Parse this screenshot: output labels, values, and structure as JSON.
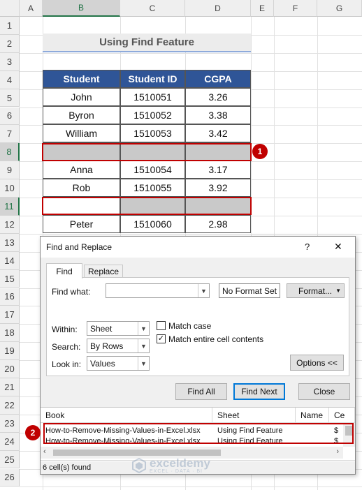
{
  "sheet": {
    "columns": [
      "A",
      "B",
      "C",
      "D",
      "E",
      "F",
      "G"
    ],
    "rows": [
      "1",
      "2",
      "3",
      "4",
      "5",
      "6",
      "7",
      "8",
      "9",
      "10",
      "11",
      "12",
      "13",
      "14",
      "15",
      "16",
      "17",
      "18",
      "19",
      "20",
      "21",
      "22",
      "23",
      "24",
      "25",
      "26"
    ],
    "title": "Using Find Feature",
    "table": {
      "headers": [
        "Student",
        "Student ID",
        "CGPA"
      ],
      "rows": [
        [
          "John",
          "1510051",
          "3.26"
        ],
        [
          "Byron",
          "1510052",
          "3.38"
        ],
        [
          "William",
          "1510053",
          "3.42"
        ],
        [
          "",
          "",
          ""
        ],
        [
          "Anna",
          "1510054",
          "3.17"
        ],
        [
          "Rob",
          "1510055",
          "3.92"
        ],
        [
          "",
          "",
          ""
        ],
        [
          "Peter",
          "1510060",
          "2.98"
        ]
      ]
    },
    "badges": [
      "1",
      "2"
    ]
  },
  "dialog": {
    "title": "Find and Replace",
    "help": "?",
    "close": "✕",
    "tabs": [
      "Find",
      "Replace"
    ],
    "find_what_label": "Find what:",
    "find_what_value": "",
    "no_format": "No Format Set",
    "format_btn": "Format...",
    "within_label": "Within:",
    "within_value": "Sheet",
    "search_label": "Search:",
    "search_value": "By Rows",
    "lookin_label": "Look in:",
    "lookin_value": "Values",
    "match_case": "Match case",
    "match_entire": "Match entire cell contents",
    "match_case_checked": false,
    "match_entire_checked": true,
    "options_btn": "Options <<",
    "find_all": "Find All",
    "find_next": "Find Next",
    "close_btn": "Close",
    "results": {
      "headers": [
        "Book",
        "Sheet",
        "Name",
        "Ce"
      ],
      "rows": [
        [
          "How-to-Remove-Missing-Values-in-Excel.xlsx",
          "Using Find Feature",
          "",
          "$"
        ],
        [
          "How-to-Remove-Missing-Values-in-Excel.xlsx",
          "Using Find Feature",
          "",
          "$"
        ]
      ]
    },
    "status": "6 cell(s) found"
  },
  "watermark": {
    "name": "exceldemy",
    "tagline": "EXCEL · DATA · BI"
  },
  "colors": {
    "header_blue": "#2f5597",
    "highlight_red": "#c00000",
    "gray_fill": "#c9c9c9"
  }
}
